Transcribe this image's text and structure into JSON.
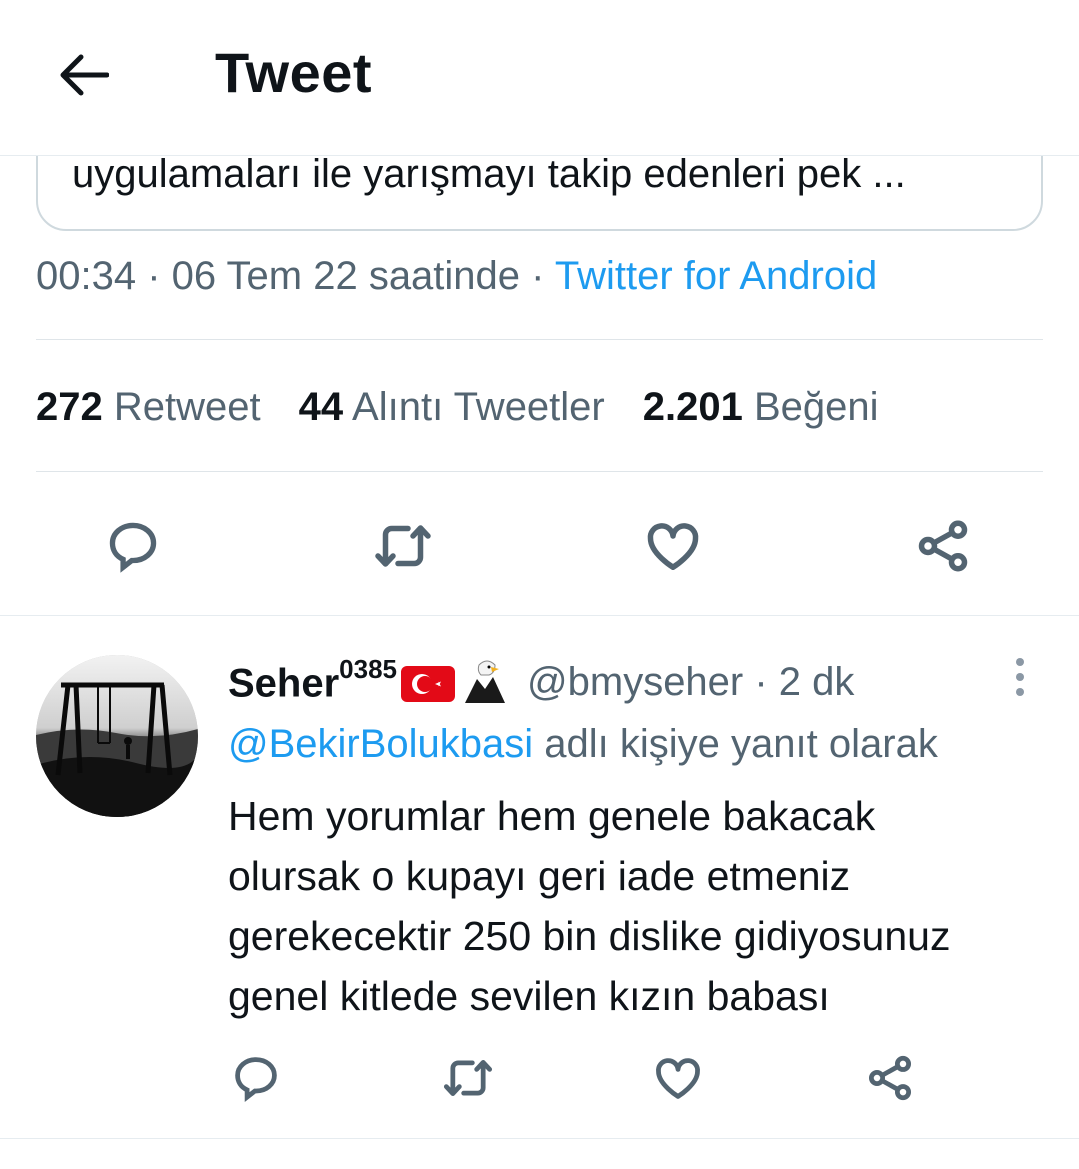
{
  "header": {
    "title": "Tweet"
  },
  "quote": {
    "text": "uygulamaları ile yarışmayı takip edenleri  pek ..."
  },
  "meta": {
    "time": "00:34 · 06 Tem 22 saatinde · ",
    "source": "Twitter for Android"
  },
  "stats": {
    "retweets_count": "272",
    "retweets_label": "Retweet",
    "quotes_count": "44",
    "quotes_label": "Alıntı Tweetler",
    "likes_count": "2.201",
    "likes_label": "Beğeni"
  },
  "reply": {
    "name": "Seher",
    "name_sup": "0385",
    "handle_time": "@bmyseher · 2 dk",
    "reply_to_mention": "@BekirBolukbasi",
    "reply_to_suffix": " adlı kişiye yanıt olarak",
    "body_lines": [
      "Hem yorumlar hem genele bakacak",
      "olursak o kupayı geri iade etmeniz",
      "gerekecektir 250 bin dislike gidiyosunuz",
      "genel kitlede sevilen kızın babası"
    ]
  },
  "icons": {
    "back": "arrow-left-icon",
    "reply": "speech-bubble-icon",
    "retweet": "retweet-icon",
    "like": "heart-icon",
    "share": "share-icon",
    "more": "vertical-dots-icon",
    "flag": "turkey-flag-emoji",
    "eagle": "eagle-emoji"
  },
  "colors": {
    "accent": "#1d9bf0",
    "text": "#0f1419",
    "secondary": "#536471",
    "border": "#cfd9de"
  }
}
